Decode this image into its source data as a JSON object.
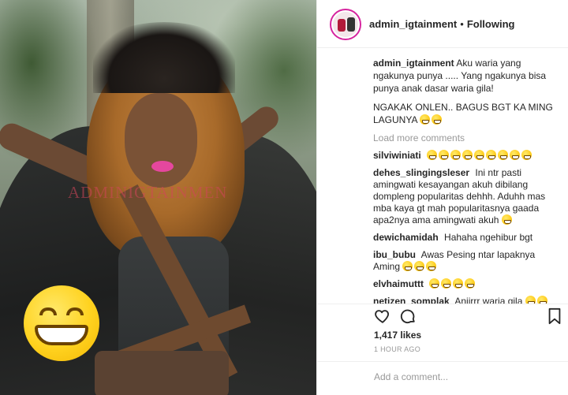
{
  "post": {
    "watermark": "ADMINIGTAINMEN",
    "header": {
      "username": "admin_igtainment",
      "separator": "•",
      "follow_status": "Following"
    },
    "caption": {
      "username": "admin_igtainment",
      "text": "Aku waria yang ngakunya punya ..... Yang ngakunya bisa punya anak dasar waria gila!",
      "text2": "NGAKAK ONLEN.. BAGUS BGT KA MING LAGUNYA"
    },
    "load_more": "Load more comments",
    "comments": [
      {
        "username": "silviwiniati",
        "text": ""
      },
      {
        "username": "dehes_slingingsleser",
        "text": "Ini ntr pasti amingwati kesayangan akuh dibilang dompleng popularitas dehhh. Aduhh mas mba kaya gt mah popularitasnya gaada apa2nya ama amingwati akuh"
      },
      {
        "username": "dewichamidah",
        "text": "Hahaha ngehibur bgt"
      },
      {
        "username": "ibu_bubu",
        "text": "Awas Pesing ntar lapaknya Aming"
      },
      {
        "username": "elvhaimuttt",
        "text": ""
      },
      {
        "username": "netizen_somplak",
        "text": "Anjirrr waria gila"
      }
    ],
    "likes": "1,417 likes",
    "time": "1 HOUR AGO",
    "add_comment_placeholder": "Add a comment...",
    "icons": {
      "like": "heart-icon",
      "comment": "comment-icon",
      "save": "bookmark-icon",
      "emoji": "grinning-emoji"
    }
  }
}
